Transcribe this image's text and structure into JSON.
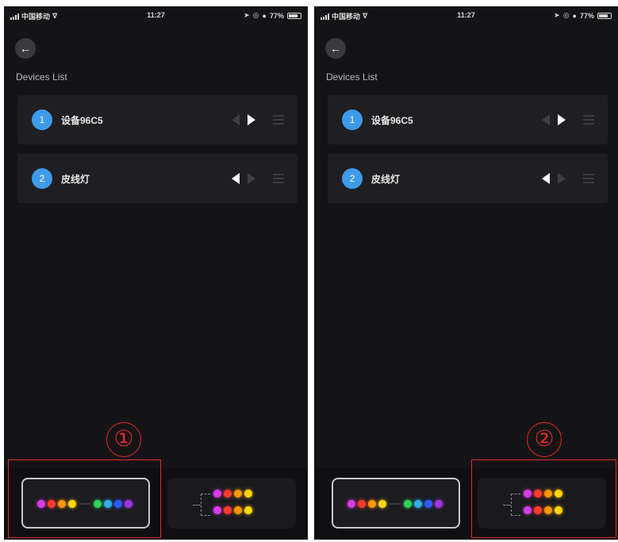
{
  "status_bar": {
    "carrier": "中国移动",
    "time": "11:27",
    "battery_percent": "77%",
    "battery_level": 0.77
  },
  "screen": {
    "back_icon": "arrow-left-icon",
    "title": "Devices List"
  },
  "devices": [
    {
      "index": "1",
      "name": "设备96C5",
      "direction_left_active_on_screen_1": false,
      "direction_right_active_on_screen_1": true
    },
    {
      "index": "2",
      "name": "皮线灯",
      "direction_left_active_on_screen_1": true,
      "direction_right_active_on_screen_1": false
    }
  ],
  "mode_selector": {
    "selected": "sequential",
    "sequential_dot_colors": [
      "#d93be6",
      "#ff3b30",
      "#ff9500",
      "#ffd60a",
      "#30d158",
      "#32ade6",
      "#2f5bff",
      "#a033e0"
    ],
    "parallel_dot_colors": [
      "#d93be6",
      "#ff3b30",
      "#ff9500",
      "#ffd60a"
    ]
  },
  "annotations": {
    "label_1": "①",
    "label_2": "②",
    "color": "#e02b2b"
  }
}
